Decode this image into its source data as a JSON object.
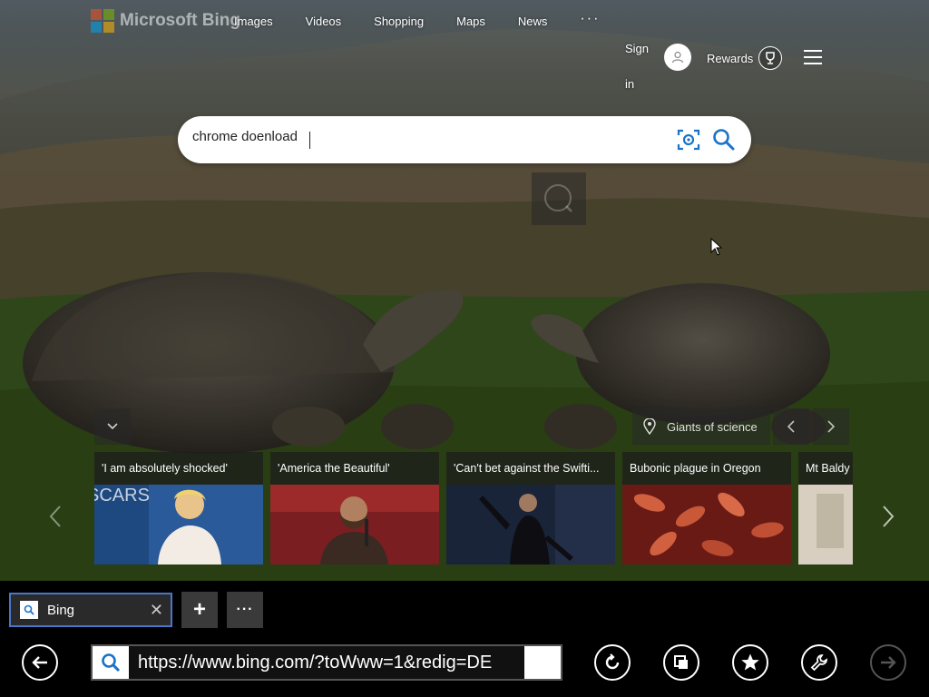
{
  "header": {
    "logo_text": "Microsoft Bing",
    "nav": [
      "Images",
      "Videos",
      "Shopping",
      "Maps",
      "News"
    ],
    "more": "···",
    "sign_in": "Sign in",
    "rewards": "Rewards"
  },
  "search": {
    "value": "chrome doenload",
    "placeholder": ""
  },
  "hero": {
    "location": "Giants of science"
  },
  "news": [
    {
      "title": "'I am absolutely shocked'"
    },
    {
      "title": "'America the Beautiful'"
    },
    {
      "title": "'Can't bet against the Swifti..."
    },
    {
      "title": "Bubonic plague in Oregon"
    },
    {
      "title": "Mt Baldy"
    }
  ],
  "news_image_text": "SCARS",
  "browser": {
    "tab_title": "Bing",
    "tab_close": "✕",
    "new_tab": "+",
    "tab_more": "···",
    "url": "https://www.bing.com/?toWww=1&redig=DE"
  },
  "colors": {
    "tab_border": "#4a76c9",
    "search_icon": "#1a73c8"
  }
}
